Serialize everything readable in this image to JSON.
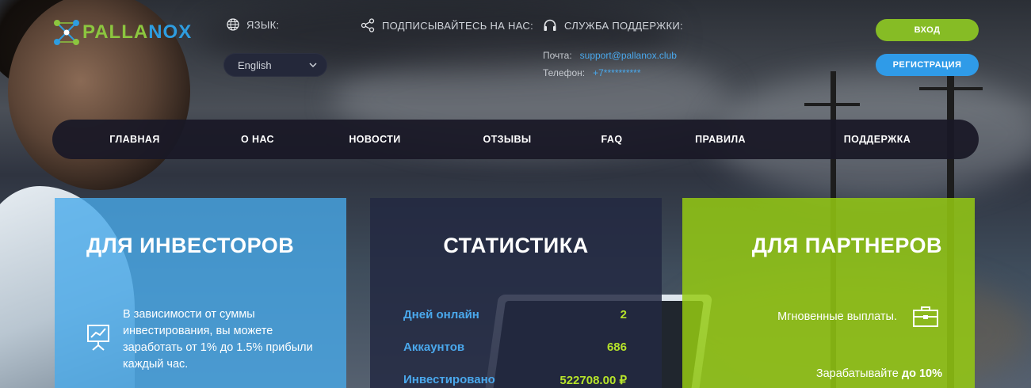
{
  "brand": {
    "name_part1": "PALLA",
    "name_part2": "NOX"
  },
  "header": {
    "language_label": "ЯЗЫК:",
    "language_selected": "English",
    "subscribe_label": "ПОДПИСЫВАЙТЕСЬ НА НАС:",
    "support_label": "СЛУЖБА ПОДДЕРЖКИ:",
    "email_label": "Почта:",
    "email_value": "support@pallanox.club",
    "phone_label": "Телефон:",
    "phone_value": "+7**********",
    "login_label": "ВХОД",
    "register_label": "РЕГИСТРАЦИЯ"
  },
  "nav": {
    "items": [
      {
        "label": "ГЛАВНАЯ"
      },
      {
        "label": "О НАС"
      },
      {
        "label": "НОВОСТИ"
      },
      {
        "label": "ОТЗЫВЫ"
      },
      {
        "label": "FAQ"
      },
      {
        "label": "ПРАВИЛА"
      },
      {
        "label": "ПОДДЕРЖКА"
      }
    ]
  },
  "investors": {
    "title": "ДЛЯ ИНВЕСТОРОВ",
    "text": "В зависимости от суммы инвестирования, вы можете заработать от 1% до 1.5% прибыли каждый час.",
    "icon": "presentation-chart-icon"
  },
  "stats": {
    "title": "СТАТИСТИКА",
    "rows": [
      {
        "label": "Дней онлайн",
        "value": "2"
      },
      {
        "label": "Аккаунтов",
        "value": "686"
      },
      {
        "label": "Инвестировано",
        "value": "522708.00 ₽"
      }
    ]
  },
  "partners": {
    "title": "ДЛЯ ПАРТНЕРОВ",
    "line1": "Мгновенные выплаты.",
    "line2_prefix": "Зарабатывайте ",
    "line2_bold": "до 10%",
    "icon": "briefcase-icon"
  },
  "colors": {
    "green": "#86bc25",
    "blue": "#2f9be8",
    "nav_bg": "#1a1826",
    "stat_value": "#b6e32a"
  }
}
